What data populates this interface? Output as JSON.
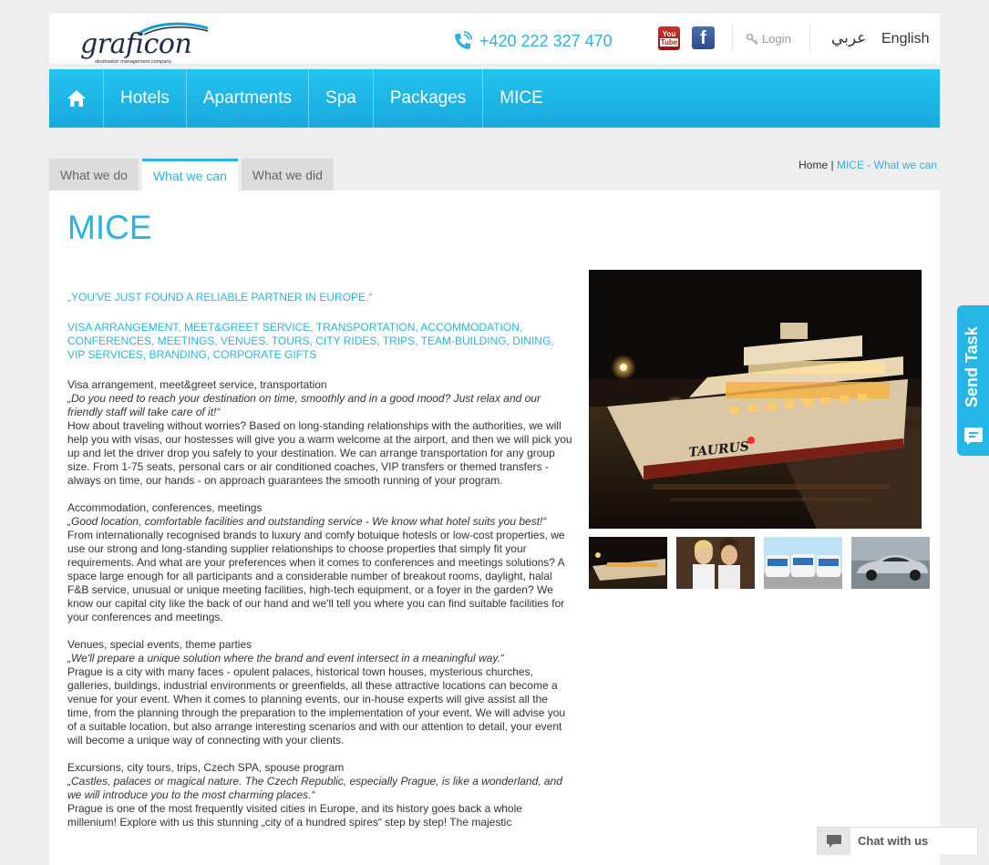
{
  "header": {
    "logo_text": "graficon",
    "logo_tagline": "destination management company",
    "phone": "+420 222 327 470",
    "login": "Login",
    "lang_arabic": "عربي",
    "lang_english": "English",
    "youtube_top": "You",
    "youtube_bottom": "Tube",
    "facebook": "f"
  },
  "nav": {
    "items": [
      {
        "label": "Hotels"
      },
      {
        "label": "Apartments"
      },
      {
        "label": "Spa"
      },
      {
        "label": "Packages"
      },
      {
        "label": "MICE"
      }
    ]
  },
  "tabs": [
    {
      "label": "What we do"
    },
    {
      "label": "What we can"
    },
    {
      "label": "What we did"
    }
  ],
  "breadcrumb": {
    "home": "Home",
    "separator": "|",
    "current": "MICE - What we can"
  },
  "page": {
    "title": "MICE",
    "quote": "„YOU'VE JUST FOUND A RELIABLE PARTNER IN EUROPE.“",
    "services": "VISA ARRANGEMENT, MEET&GREET SERVICE, TRANSPORTATION, ACCOMMODATION, CONFERENCES, MEETINGS, VENUES, TOURS, CITY RIDES, TRIPS, TEAM-BUILDING, DINING, VIP SERVICES, BRANDING, CORPORATE GIFTS",
    "sections": [
      {
        "title": "Visa arrangement, meet&greet service, transportation",
        "quote": "„Do you need to reach your destination on time, smoothly and in a good mood? Just relax and our friendly staff will take care of it!“",
        "body": "How about traveling without worries? Based on long-standing relationships with the authorities, we will help you with visas, our hostesses will give you a warm welcome at the airport, and then we will pick you up and let the driver drop you safely to your destination. We can arrange transportation for any group size. From 1-75 seats, personal cars or air conditioned coaches, VIP transfers or themed transfers - always on time, our hands - on approach guarantees the smooth running of your program."
      },
      {
        "title": "Accommodation, conferences, meetings",
        "quote": "„Good location, comfortable facilities and outstanding service - We know what hotel suits you best!“",
        "body": "From internationally recognised brands to luxury and comfy botuique hotesls or low-cost properties, we use our strong and long-standing supplier relationships to choose properties that simply fit your requirements. And what are your preferences when it comes to conferences and meetings solutions? A space large enough for all participants and a considerable number of breakout rooms, daylight, halal F&B service, unusual or unique meeting facilities, high-tech equipment, or a foyer in the garden? We know our capital city like the back of our hand and we'll tell you where you can find suitable facilities for your conferences and meetings."
      },
      {
        "title": "Venues, special events, theme parties",
        "quote": "„We'll prepare a unique solution where the brand and event intersect in a meaningful way.“",
        "body": "Prague is a city with many faces - opulent palaces, historical town houses, mysterious churches, galleries, buildings, industrial environments or greenfields, all these attractive locations can become a venue for your event. When it comes to planning events, our in-house experts will give assist all the time, from the planning through the preparation to the implementation of your event. We will advise you of a suitable location, but also arrange interesting scenarios and with our attention to detail, your event will become a unique way of connecting with your clients."
      },
      {
        "title": "Excursions, city tours, trips, Czech SPA, spouse program",
        "quote": "„Castles, palaces or magical nature. The Czech Republic, especially Prague, is like a wonderland, and we will introduce you to the most charming places.“",
        "body": "Prague is one of the most frequently visited cities in Europe, and its history goes back a whole millenium! Explore with us this stunning „city of a hundred spires“ step by step! The majestic"
      }
    ]
  },
  "photo": {
    "boat_name": "TAURUS"
  },
  "widgets": {
    "send_task": "Send Task",
    "chat": "Chat with us"
  },
  "colors": {
    "accent": "#2bb3e0",
    "nav_bg": "#1fb7e8",
    "page_bg": "#eeeeee"
  }
}
